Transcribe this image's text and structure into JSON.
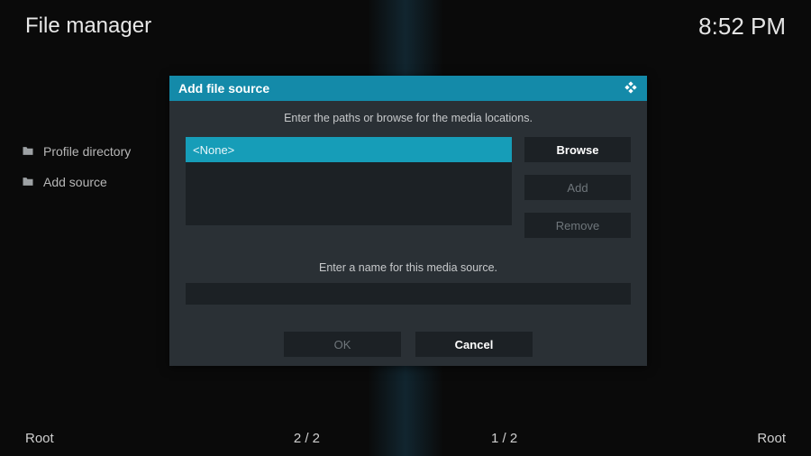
{
  "header": {
    "title": "File manager",
    "clock": "8:52 PM"
  },
  "sidebar": {
    "items": [
      {
        "label": "Profile directory"
      },
      {
        "label": "Add source"
      }
    ]
  },
  "footer": {
    "root_left": "Root",
    "count_left": "2 / 2",
    "count_right": "1 / 2",
    "root_right": "Root"
  },
  "dialog": {
    "title": "Add file source",
    "instruction": "Enter the paths or browse for the media locations.",
    "path_value": "<None>",
    "browse": "Browse",
    "add": "Add",
    "remove": "Remove",
    "name_label": "Enter a name for this media source.",
    "name_value": "",
    "ok": "OK",
    "cancel": "Cancel"
  }
}
